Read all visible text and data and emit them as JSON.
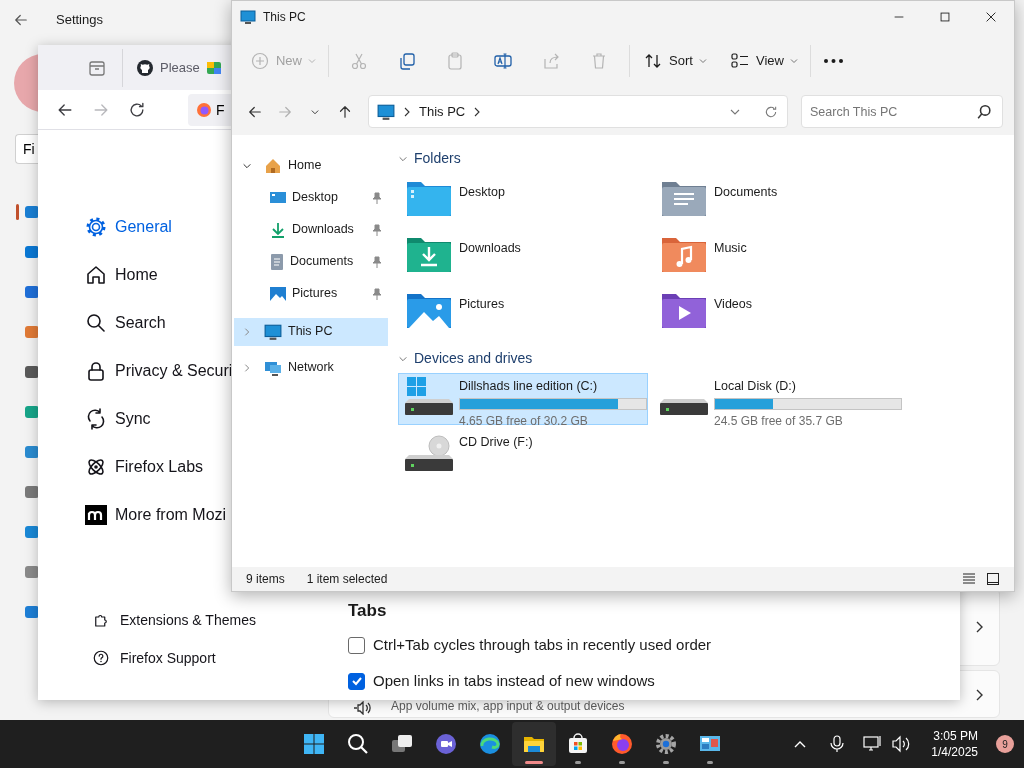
{
  "settings_app": {
    "title": "Settings",
    "search": {
      "value": "Fi"
    },
    "nav": [
      {
        "kind": "system",
        "selected": true
      },
      {
        "kind": "bluetooth",
        "selected": false
      },
      {
        "kind": "network",
        "selected": false
      },
      {
        "kind": "personalization",
        "selected": false
      },
      {
        "kind": "apps",
        "selected": false
      },
      {
        "kind": "accounts",
        "selected": false
      },
      {
        "kind": "time",
        "selected": false
      },
      {
        "kind": "gaming",
        "selected": false
      },
      {
        "kind": "accessibility",
        "selected": false
      },
      {
        "kind": "privacy",
        "selected": false
      },
      {
        "kind": "update",
        "selected": false
      }
    ],
    "cards": [
      {
        "expandable": true
      },
      {
        "expandable": true,
        "description": "App volume mix, app input & output devices"
      }
    ]
  },
  "browser": {
    "tabs": [
      {
        "kind": "github",
        "label": "Please"
      },
      {
        "kind": "colorful"
      }
    ],
    "nav_buttons": [
      {
        "kind": "back",
        "disabled": false
      },
      {
        "kind": "forward",
        "disabled": true
      },
      {
        "kind": "reload",
        "disabled": false
      }
    ],
    "address": {
      "value": "F"
    },
    "sidebar": [
      {
        "kind": "gear",
        "label": "General",
        "selected": true
      },
      {
        "kind": "house",
        "label": "Home",
        "selected": false
      },
      {
        "kind": "search",
        "label": "Search",
        "selected": false
      },
      {
        "kind": "lock",
        "label": "Privacy & Securi",
        "selected": false
      },
      {
        "kind": "sync",
        "label": "Sync",
        "selected": false
      },
      {
        "kind": "atom",
        "label": "Firefox Labs",
        "selected": false
      },
      {
        "kind": "mozilla",
        "label": "More from Mozi",
        "selected": false
      }
    ],
    "footer_links": [
      {
        "kind": "puzzle",
        "label": "Extensions & Themes"
      },
      {
        "kind": "help",
        "label": "Firefox Support"
      }
    ],
    "section": {
      "heading": "Tabs",
      "options": [
        {
          "label": "Ctrl+Tab cycles through tabs in recently used order",
          "checked": false
        },
        {
          "label": "Open links in tabs instead of new windows",
          "checked": true
        }
      ]
    }
  },
  "explorer": {
    "title": "This PC",
    "toolbar": [
      {
        "kind": "new",
        "label": "New",
        "disabled": true
      },
      {
        "kind": "cut",
        "disabled": true
      },
      {
        "kind": "copy",
        "disabled": false
      },
      {
        "kind": "paste",
        "disabled": true
      },
      {
        "kind": "rename",
        "disabled": false
      },
      {
        "kind": "share",
        "disabled": true
      },
      {
        "kind": "delete",
        "disabled": true
      },
      {
        "kind": "sort",
        "label": "Sort",
        "disabled": false
      },
      {
        "kind": "view",
        "label": "View",
        "disabled": false
      },
      {
        "kind": "more",
        "disabled": false
      }
    ],
    "nav_buttons": [
      {
        "kind": "back",
        "disabled": false
      },
      {
        "kind": "forward",
        "disabled": true
      },
      {
        "kind": "recent",
        "disabled": false
      },
      {
        "kind": "up",
        "disabled": false
      }
    ],
    "breadcrumb": [
      "This PC"
    ],
    "search": {
      "placeholder": "Search This PC"
    },
    "tree": [
      {
        "kind": "home",
        "label": "Home",
        "expanded": true,
        "selected": false,
        "children": [
          {
            "kind": "desktop",
            "label": "Desktop",
            "pinned": true,
            "selected": false
          },
          {
            "kind": "downloads",
            "label": "Downloads",
            "pinned": true,
            "selected": false
          },
          {
            "kind": "documents",
            "label": "Documents",
            "pinned": true,
            "selected": false
          },
          {
            "kind": "pictures",
            "label": "Pictures",
            "pinned": true,
            "selected": false
          }
        ]
      },
      {
        "kind": "pc",
        "label": "This PC",
        "expanded": false,
        "selected": true
      },
      {
        "kind": "network",
        "label": "Network",
        "expanded": false,
        "selected": false
      }
    ],
    "sections": [
      {
        "kind": "folders",
        "title": "Folders",
        "expanded": true,
        "items": [
          {
            "kind": "desktop",
            "name": "Desktop",
            "selected": false
          },
          {
            "kind": "documents",
            "name": "Documents",
            "selected": false
          },
          {
            "kind": "downloads",
            "name": "Downloads",
            "selected": false
          },
          {
            "kind": "music",
            "name": "Music",
            "selected": false
          },
          {
            "kind": "pictures",
            "name": "Pictures",
            "selected": false
          },
          {
            "kind": "videos",
            "name": "Videos",
            "selected": false
          }
        ]
      },
      {
        "kind": "drives",
        "title": "Devices and drives",
        "expanded": true,
        "items": [
          {
            "kind": "system",
            "name": "Dillshads line edition (C:)",
            "selected": true,
            "level": 0.85,
            "reading": "4.65 GB free of 30.2 GB"
          },
          {
            "kind": "disk",
            "name": "Local Disk (D:)",
            "selected": false,
            "level": 0.31,
            "reading": "24.5 GB free of 35.7 GB"
          },
          {
            "kind": "cd",
            "name": "CD Drive (F:)",
            "selected": false
          }
        ]
      }
    ],
    "status": {
      "count": "9 items",
      "selection": "1 item selected"
    }
  },
  "taskbar": {
    "apps": [
      {
        "kind": "start",
        "running": false,
        "active": false
      },
      {
        "kind": "search",
        "running": false,
        "active": false
      },
      {
        "kind": "taskview",
        "running": false,
        "active": false
      },
      {
        "kind": "meet",
        "running": false,
        "active": false
      },
      {
        "kind": "edge",
        "running": false,
        "active": false
      },
      {
        "kind": "explorer",
        "running": true,
        "active": true
      },
      {
        "kind": "store",
        "running": true,
        "active": false
      },
      {
        "kind": "firefox",
        "running": true,
        "active": false
      },
      {
        "kind": "settings",
        "running": true,
        "active": false
      },
      {
        "kind": "control",
        "running": true,
        "active": false
      }
    ],
    "clock": {
      "time": "3:05 PM",
      "date": "1/4/2025"
    },
    "notifications": "9"
  }
}
